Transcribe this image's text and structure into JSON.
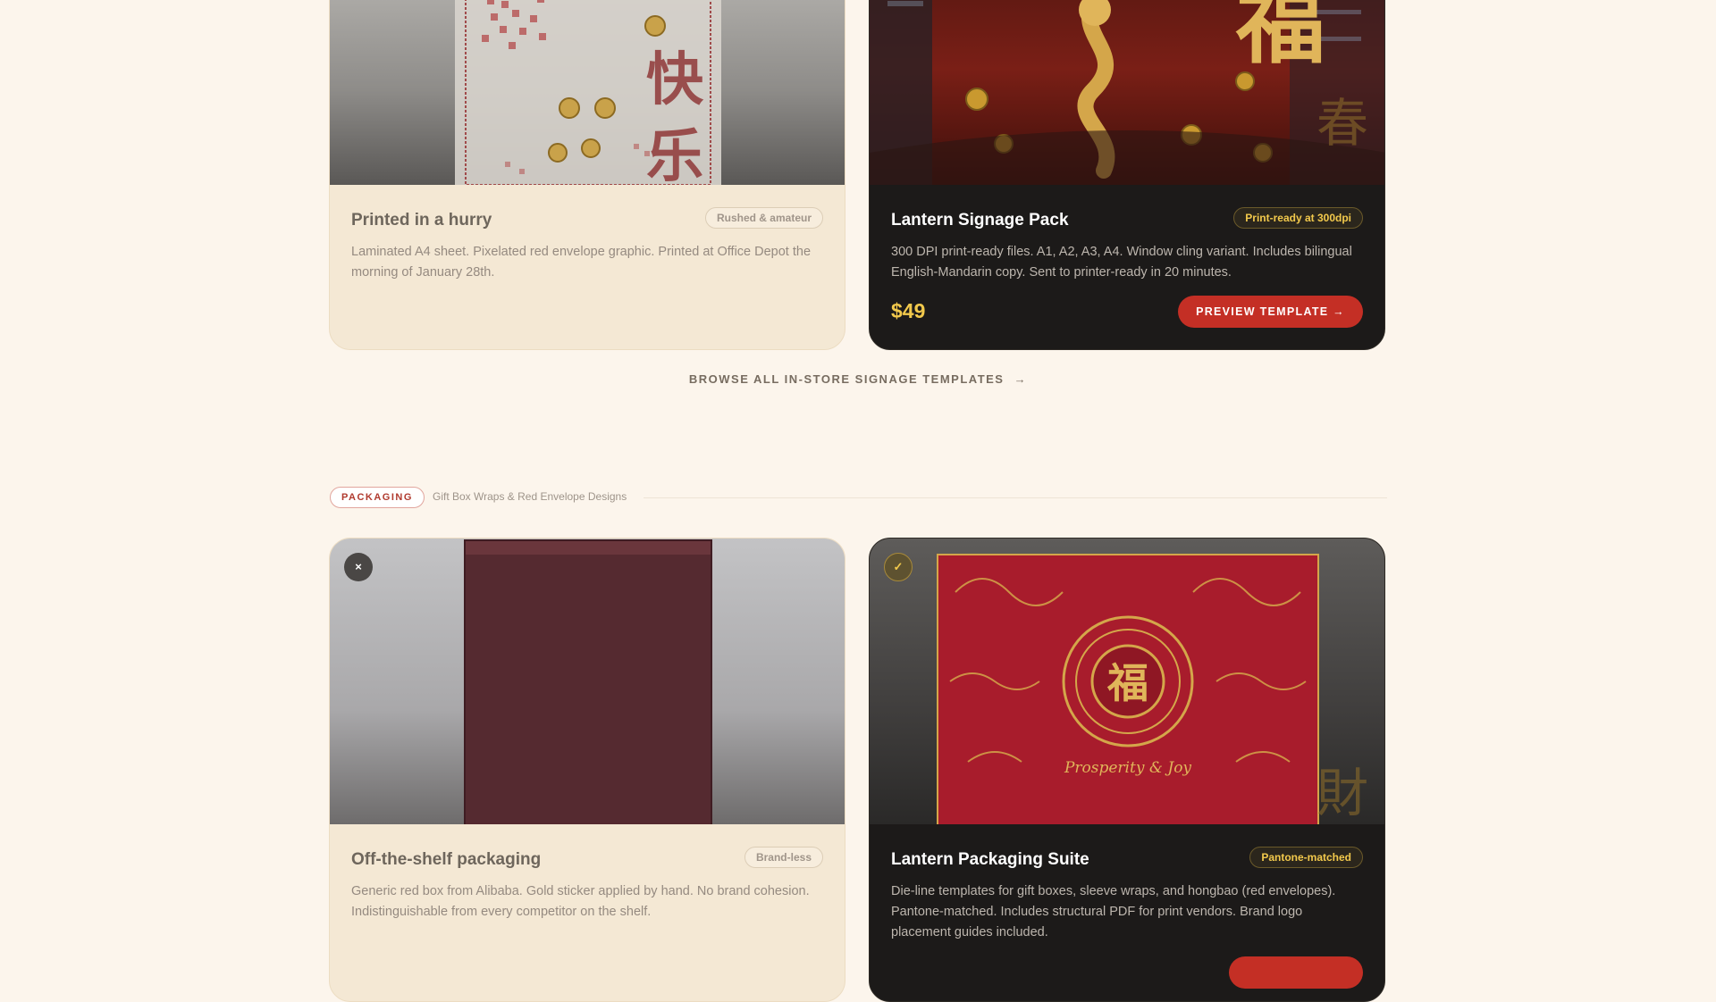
{
  "signage": {
    "before": {
      "title": "Printed in a hurry",
      "badge": "Rushed & amateur",
      "desc": "Laminated A4 sheet. Pixelated red envelope graphic. Printed at Office Depot the morning of January 28th.",
      "image_chars": [
        "快",
        "乐"
      ]
    },
    "after": {
      "title": "Lantern Signage Pack",
      "badge": "Print-ready at 300dpi",
      "desc": "300 DPI print-ready files. A1, A2, A3, A4. Window cling variant. Includes bilingual English-Mandarin copy. Sent to printer-ready in 20 minutes.",
      "price": "$49",
      "cta": "PREVIEW TEMPLATE →",
      "image_chars": [
        "福"
      ],
      "glyph": "春"
    },
    "browse_link": "BROWSE ALL IN-STORE SIGNAGE TEMPLATES",
    "browse_arrow": "→"
  },
  "packaging_section": {
    "tag": "PACKAGING",
    "subtitle": "Gift Box Wraps & Red Envelope Designs"
  },
  "packaging": {
    "before": {
      "status_icon": "×",
      "title": "Off-the-shelf packaging",
      "badge": "Brand-less",
      "desc": "Generic red box from Alibaba. Gold sticker applied by hand. No brand cohesion. Indistinguishable from every competitor on the shelf."
    },
    "after": {
      "status_icon": "✓",
      "title": "Lantern Packaging Suite",
      "badge": "Pantone-matched",
      "desc": "Die-line templates for gift boxes, sleeve wraps, and hongbao (red envelopes). Pantone-matched. Includes structural PDF for print vendors. Brand logo placement guides included.",
      "image_chars": [
        "福"
      ],
      "box_script": "Prosperity & Joy",
      "glyph": "財"
    }
  },
  "colors": {
    "page_bg": "#fcf5ec",
    "accent_red": "#c42f25",
    "gold": "#f2c94c",
    "dark_card": "#1c1a19",
    "light_card": "#f4e8d4"
  }
}
